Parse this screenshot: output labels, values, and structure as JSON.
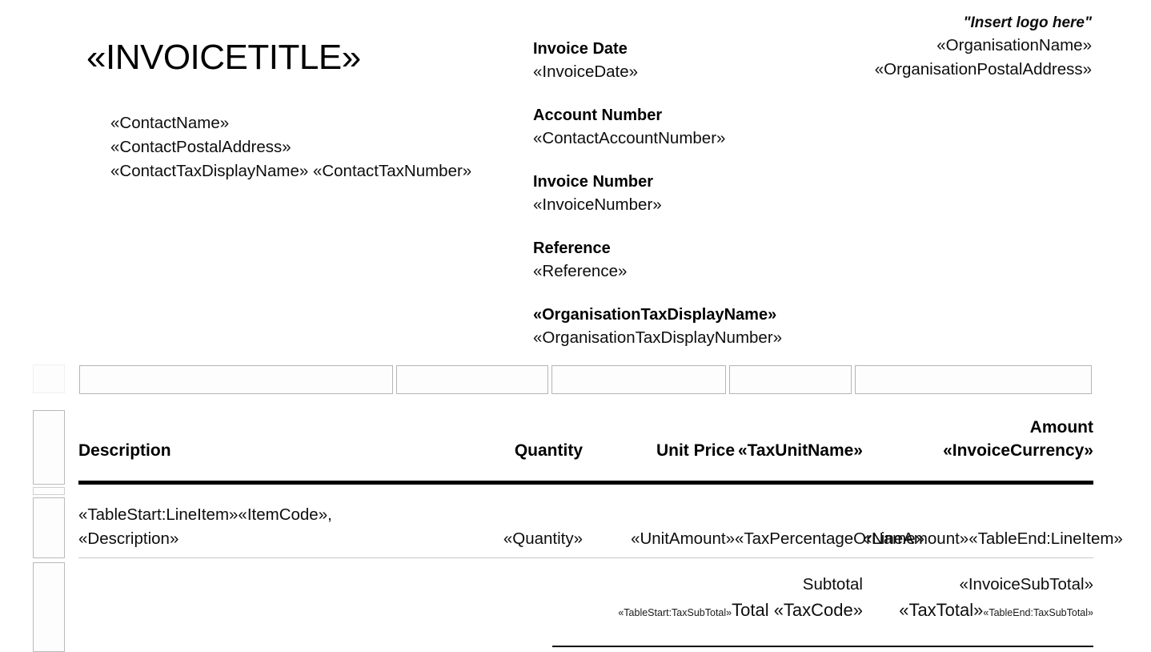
{
  "document": {
    "title": "«INVOICETITLE»"
  },
  "contact": {
    "name": "«ContactName»",
    "postal_address": "«ContactPostalAddress»",
    "tax_line": "«ContactTaxDisplayName» «ContactTaxNumber»"
  },
  "details": {
    "fields": [
      {
        "label": "Invoice Date",
        "value": "«InvoiceDate»"
      },
      {
        "label": "Account Number",
        "value": "«ContactAccountNumber»"
      },
      {
        "label": "Invoice Number",
        "value": "«InvoiceNumber»"
      },
      {
        "label": "Reference",
        "value": "«Reference»"
      },
      {
        "label": "«OrganisationTaxDisplayName»",
        "value": "«OrganisationTaxDisplayNumber»"
      }
    ]
  },
  "organisation": {
    "logo_placeholder": "\"Insert logo here\"",
    "name": "«OrganisationName»",
    "postal_address": "«OrganisationPostalAddress»"
  },
  "items_table": {
    "headers": {
      "description": "Description",
      "quantity": "Quantity",
      "unit_price": "Unit Price",
      "tax": "«TaxUnitName»",
      "amount_line1": "Amount",
      "amount_line2": "«InvoiceCurrency»"
    },
    "row": {
      "description_line1": "«TableStart:LineItem»«ItemCode»,",
      "description_line2": "«Description»",
      "quantity": "«Quantity»",
      "unit_price": "«UnitAmount»",
      "tax": "«TaxPercentageOrName»",
      "amount": "«LineAmount»«TableEnd:LineItem»"
    }
  },
  "totals": {
    "subtotal_label": "Subtotal",
    "subtotal_value": "«InvoiceSubTotal»",
    "tax_prefix": "«TableStart:TaxSubTotal»",
    "tax_label": "Total «TaxCode»",
    "tax_value": "«TaxTotal»",
    "tax_suffix": "«TableEnd:TaxSubTotal»"
  },
  "colors": {
    "rule_dark": "#000000",
    "rule_light": "#c9c9c9",
    "cell_border": "#b5b5b5",
    "text": "#0d0d0d"
  }
}
